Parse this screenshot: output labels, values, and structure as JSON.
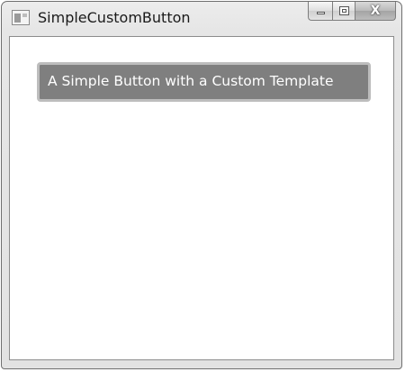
{
  "window": {
    "title": "SimpleCustomButton",
    "icon": "app-window-icon",
    "controls": {
      "minimize_icon": "minimize-icon",
      "maximize_icon": "maximize-icon",
      "close_icon": "close-icon",
      "close_glyph": "X"
    }
  },
  "content": {
    "button_label": "A Simple Button with a Custom Template",
    "button_background": "#7f7f7f",
    "button_border": "#bdbdbd",
    "button_text_color": "#ffffff"
  }
}
